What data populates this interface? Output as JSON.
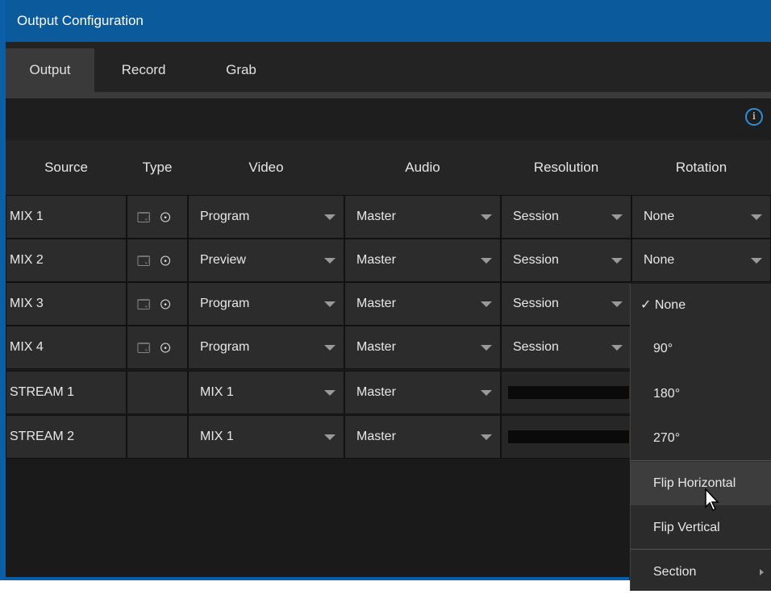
{
  "window": {
    "title": "Output Configuration"
  },
  "tabs": [
    {
      "label": "Output",
      "active": true
    },
    {
      "label": "Record",
      "active": false
    },
    {
      "label": "Grab",
      "active": false
    }
  ],
  "info_icon_glyph": "i",
  "table": {
    "headers": [
      "Source",
      "Type",
      "Video",
      "Audio",
      "Resolution",
      "Rotation"
    ],
    "rows": [
      {
        "source": "MIX 1",
        "type_icons": "🗔 ⊙",
        "video": "Program",
        "audio": "Master",
        "resolution": "Session",
        "rotation": "None"
      },
      {
        "source": "MIX 2",
        "type_icons": "🗔 ⊙",
        "video": "Preview",
        "audio": "Master",
        "resolution": "Session",
        "rotation": "None"
      },
      {
        "source": "MIX 3",
        "type_icons": "🗔 ⊙",
        "video": "Program",
        "audio": "Master",
        "resolution": "Session",
        "rotation": ""
      },
      {
        "source": "MIX 4",
        "type_icons": "🗔 ⊙",
        "video": "Program",
        "audio": "Master",
        "resolution": "Session",
        "rotation": ""
      },
      {
        "source": "STREAM 1",
        "type_icons": "",
        "video": "MIX 1",
        "audio": "Master",
        "resolution": "",
        "rotation": ""
      },
      {
        "source": "STREAM 2",
        "type_icons": "",
        "video": "MIX 1",
        "audio": "Master",
        "resolution": "",
        "rotation": ""
      }
    ]
  },
  "rotation_menu": {
    "items": [
      {
        "label": "✓ None",
        "checked": true
      },
      {
        "label": "90°"
      },
      {
        "label": "180°"
      },
      {
        "label": "270°"
      },
      {
        "label": "Flip Horizontal",
        "hover": true
      },
      {
        "label": "Flip Vertical"
      },
      {
        "label": "Section",
        "submenu": true
      }
    ]
  },
  "colors": {
    "title_bar": "#0b5a9c",
    "accent": "#2e8fd8",
    "background": "#1a1a1a"
  }
}
